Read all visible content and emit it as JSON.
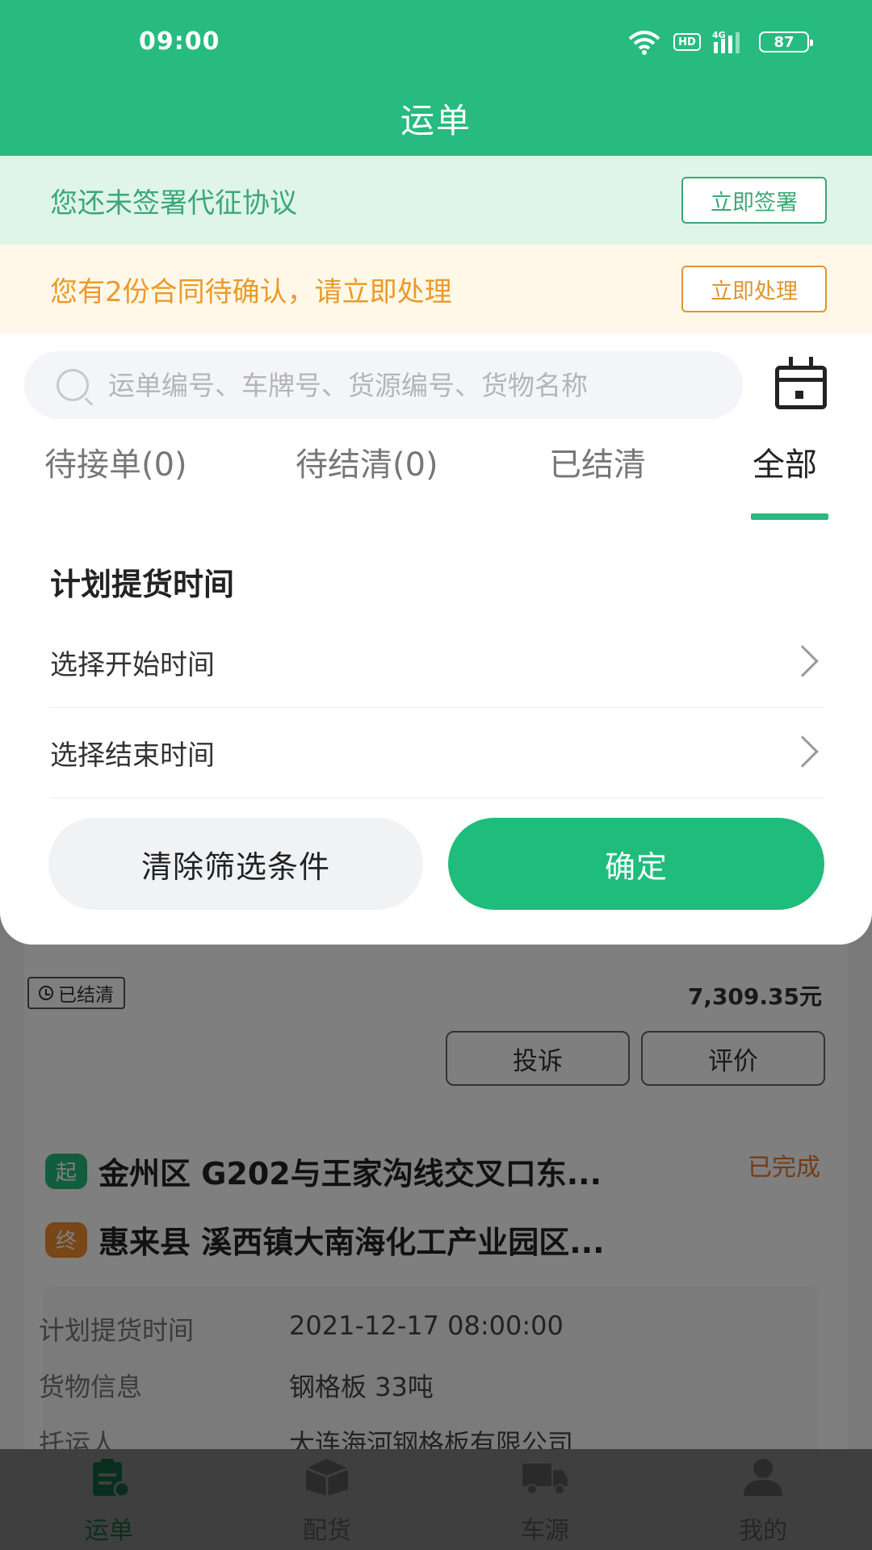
{
  "status_bar": {
    "time": "09:00",
    "hd": "HD",
    "network": "4G",
    "battery": "87"
  },
  "nav": {
    "title": "运单"
  },
  "notices": {
    "agreement": {
      "text": "您还未签署代征协议",
      "button": "立即签署"
    },
    "contracts": {
      "text": "您有2份合同待确认，请立即处理",
      "button": "立即处理"
    }
  },
  "search": {
    "placeholder": "运单编号、车牌号、货源编号、货物名称"
  },
  "tabs": [
    {
      "label": "待接单(0)"
    },
    {
      "label": "待结清(0)"
    },
    {
      "label": "已结清"
    },
    {
      "label": "全部"
    }
  ],
  "filter": {
    "section_title": "计划提货时间",
    "start_time_label": "选择开始时间",
    "end_time_label": "选择结束时间",
    "clear_button": "清除筛选条件",
    "confirm_button": "确定"
  },
  "orders": [
    {
      "badge": "已结清",
      "amount": "7,309.35元",
      "complain_button": "投诉",
      "rate_button": "评价"
    },
    {
      "start_tag": "起",
      "start_address": "金州区 G202与王家沟线交叉口东...",
      "end_tag": "终",
      "end_address": "惠来县 溪西镇大南海化工产业园区...",
      "status": "已完成",
      "details": [
        {
          "label": "计划提货时间",
          "value": "2021-12-17 08:00:00"
        },
        {
          "label": "货物信息",
          "value": "钢格板 33吨"
        },
        {
          "label": "托运人",
          "value": "大连海河钢格板有限公司"
        }
      ]
    }
  ],
  "tabbar": [
    {
      "label": "运单",
      "icon": "waybill-icon",
      "active": true
    },
    {
      "label": "配货",
      "icon": "box-icon",
      "active": false
    },
    {
      "label": "车源",
      "icon": "truck-icon",
      "active": false
    },
    {
      "label": "我的",
      "icon": "user-icon",
      "active": false
    }
  ],
  "colors": {
    "primary": "#27bb7f",
    "warning": "#ea9a2a",
    "status_done": "#e57a2c"
  }
}
